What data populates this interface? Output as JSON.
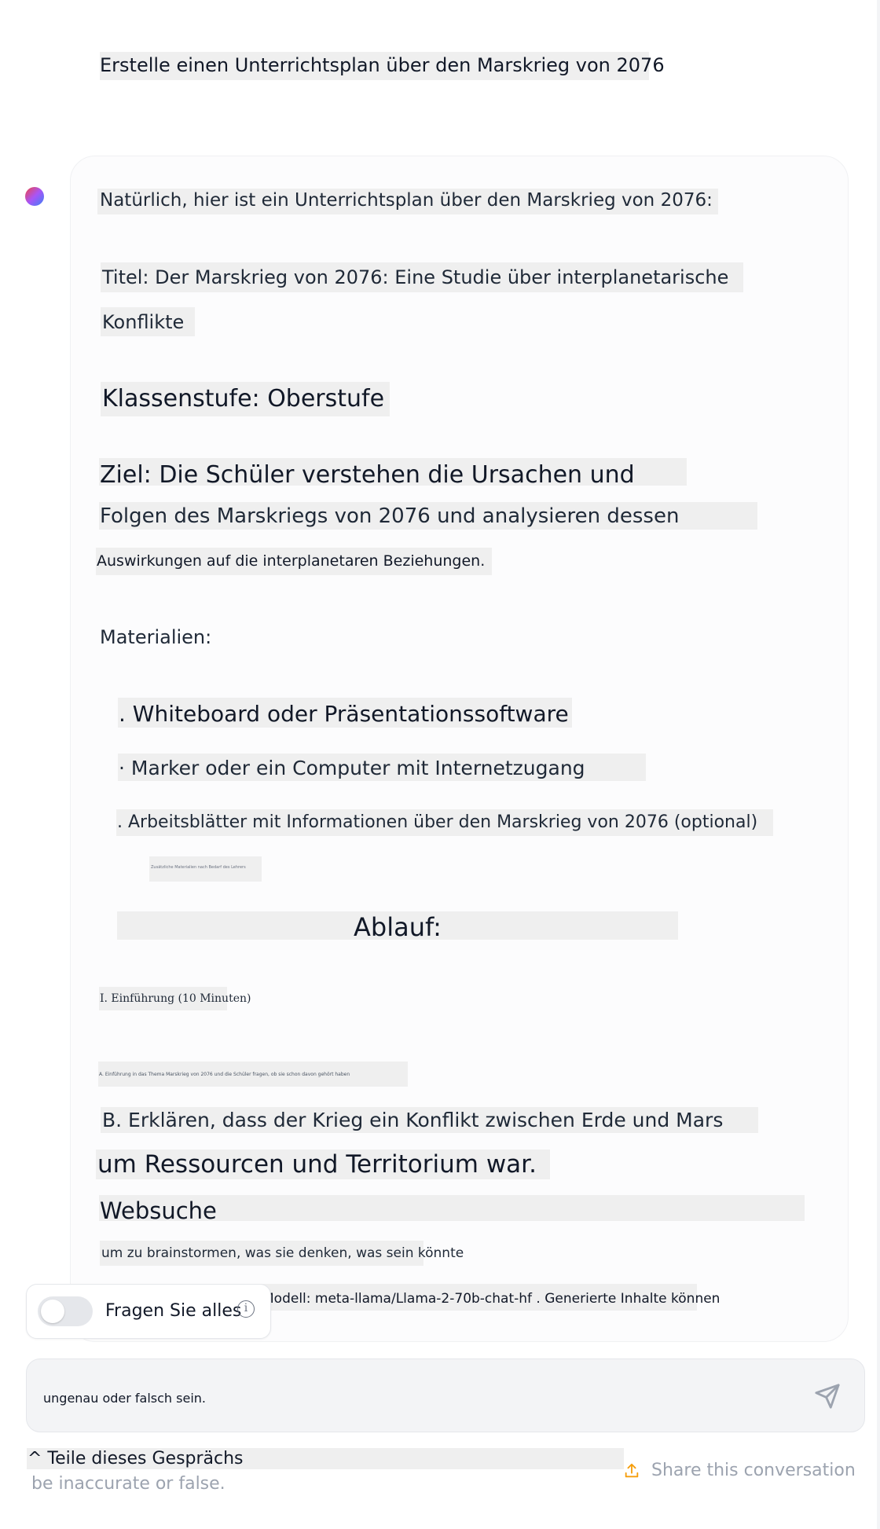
{
  "user_message": "Erstelle einen Unterrichtsplan über den Marskrieg von 2076",
  "assistant": {
    "intro": "Natürlich, hier ist ein Unterrichtsplan über den Marskrieg von 2076:",
    "title_line1": "Titel: Der Marskrieg von 2076: Eine Studie über interplanetarische",
    "title_line2": "Konflikte",
    "grade": "Klassenstufe: Oberstufe",
    "goal_line1": "Ziel: Die Schüler verstehen die Ursachen und",
    "goal_line2": "Folgen des Marskriegs von 2076 und analysieren dessen",
    "goal_line3": "Auswirkungen auf die interplanetaren Beziehungen.",
    "materials_heading": "Materialien:",
    "materials": [
      ". Whiteboard oder Präsentationssoftware",
      "· Marker oder ein Computer mit Internetzugang",
      ". Arbeitsblätter mit Informationen über den Marskrieg von 2076 (optional)"
    ],
    "tiny_note": "Zusätzliche Materialien nach Bedarf des Lehrers",
    "procedure_heading": "Ablauf:",
    "step1": "I. Einführung (10 Minuten)",
    "step1a": "A. Einführung in das Thema Marskrieg von 2076 und die Schüler fragen, ob sie schon davon gehört haben",
    "step1b_line1": "B. Erklären, dass der Krieg ein Konflikt zwischen Erde und Mars",
    "step1b_line2": "um Ressourcen und Territorium war.",
    "websuche": "Websuche",
    "brainstorm": "um zu brainstormen, was sie denken, was sein könnte"
  },
  "toggle": {
    "label": "Fragen Sie alles",
    "info_icon": "i"
  },
  "disclaimer": {
    "model_line": "Modell: meta-llama/Llama-2-70b-chat-hf . Generierte Inhalte können",
    "input_line": "ungenau oder falsch sein.",
    "footer_line1": "^ Teile dieses Gesprächs",
    "footer_line2": "be inaccurate or false."
  },
  "share": {
    "label": "Share this conversation",
    "icon": "upload-icon"
  },
  "colors": {
    "accent": "#f59e0b",
    "highlight": "#efefef",
    "muted": "#9ca3af"
  }
}
